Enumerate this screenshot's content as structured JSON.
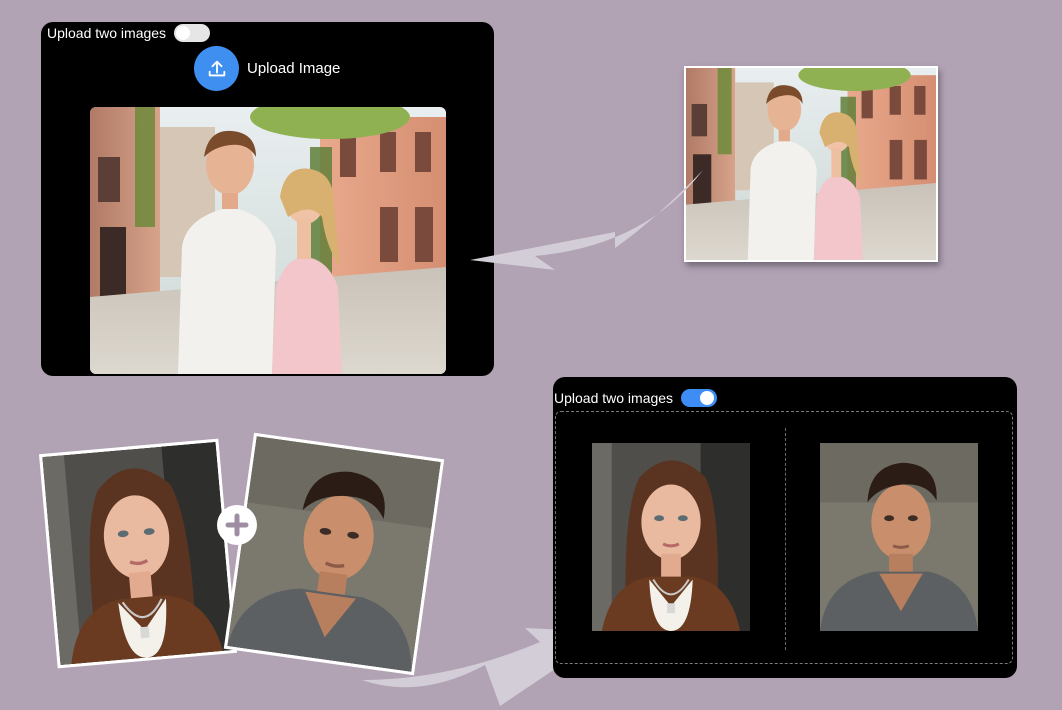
{
  "top_panel": {
    "toggle": {
      "label": "Upload two images",
      "state": "off"
    },
    "upload_button": {
      "label": "Upload Image",
      "icon": "upload-icon"
    },
    "preview_image": "couple-on-street-photo"
  },
  "source_photo": "couple-on-street-thumbnail",
  "pair_photos": {
    "left": "woman-portrait-photo",
    "plus_icon": "plus-icon",
    "right": "man-portrait-photo"
  },
  "bottom_panel": {
    "toggle": {
      "label": "Upload two images",
      "state": "on"
    },
    "slots": [
      "woman-portrait-photo",
      "man-portrait-photo"
    ]
  },
  "colors": {
    "background": "#b1a2b4",
    "panel": "#000000",
    "accent": "#3d8df5",
    "arrow": "#d2cdd6"
  }
}
